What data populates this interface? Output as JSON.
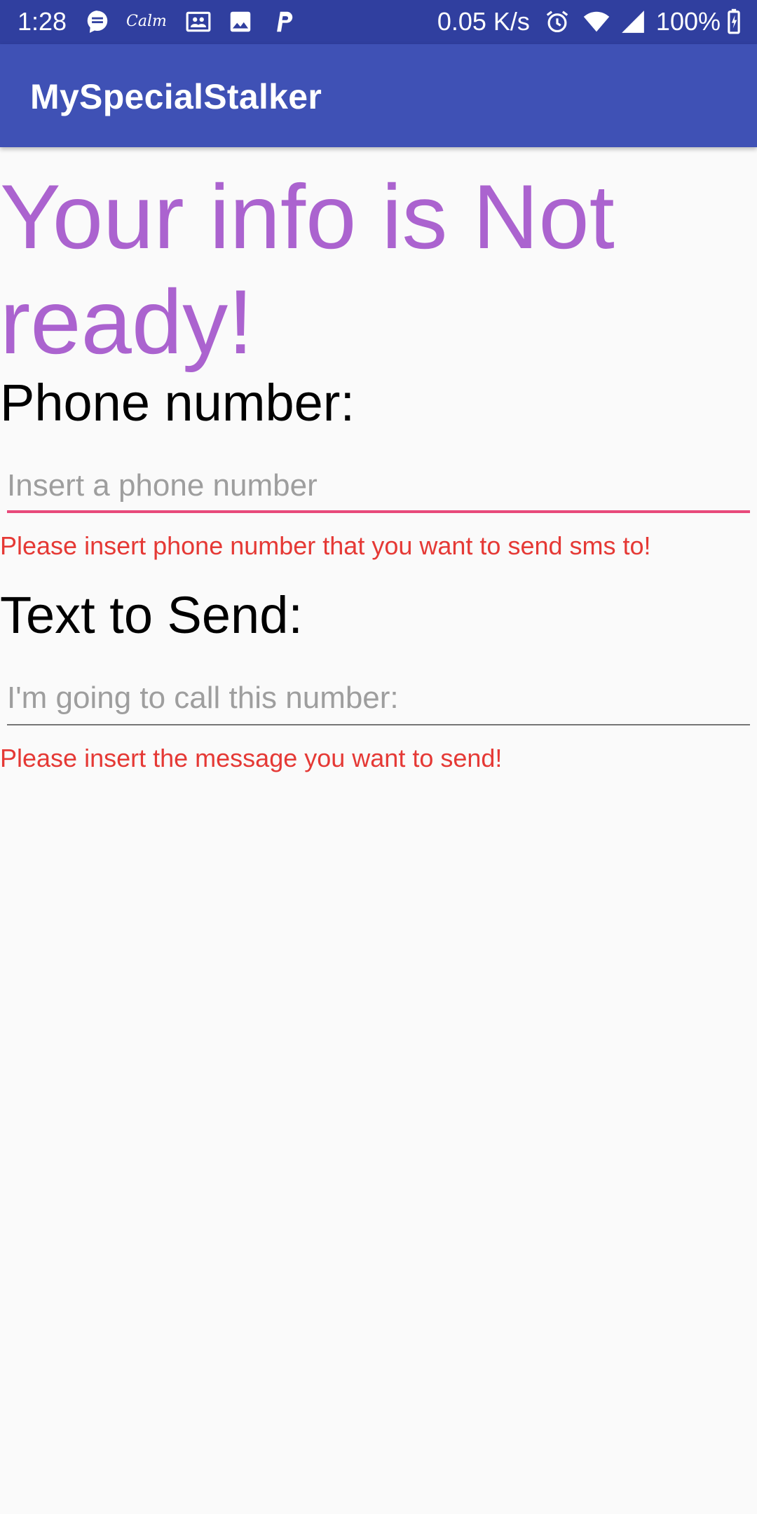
{
  "status_bar": {
    "time": "1:28",
    "calm_label": "Calm",
    "network_speed": "0.05 K/s",
    "battery_percent": "100%",
    "icons_left": [
      "chat-bubble-icon",
      "calm-app-icon",
      "contacts-card-icon",
      "image-icon",
      "paypal-icon"
    ],
    "icons_right": [
      "alarm-icon",
      "wifi-icon",
      "signal-icon",
      "battery-icon"
    ]
  },
  "app_bar": {
    "title": "MySpecialStalker"
  },
  "main": {
    "headline": "Your info is Not ready!",
    "phone": {
      "label": "Phone number:",
      "value": "",
      "placeholder": "Insert a phone number",
      "error": "Please insert phone number that you want to send sms to!"
    },
    "message": {
      "label": "Text to Send:",
      "value": "",
      "placeholder": "I'm going to call this number:",
      "error": "Please insert the message you want to send!"
    }
  },
  "colors": {
    "status_bar": "#303f9f",
    "app_bar": "#3f51b5",
    "headline": "#ab63cf",
    "error": "#e53935",
    "focused_underline": "#e84a7b",
    "default_underline": "#757575",
    "background": "#fafafa"
  }
}
